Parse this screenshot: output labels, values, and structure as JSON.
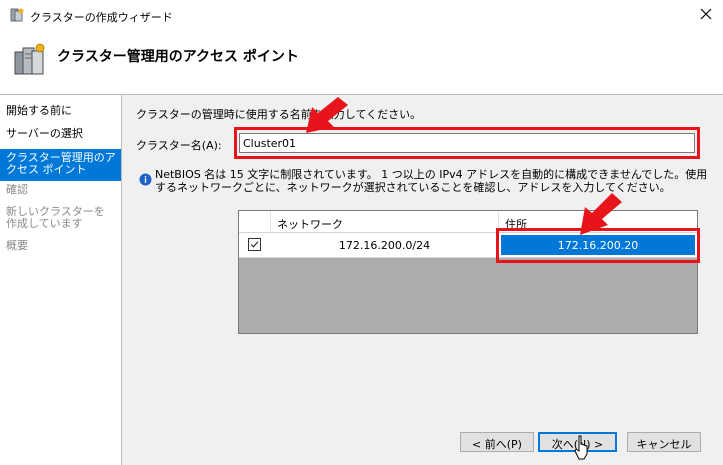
{
  "window": {
    "title": "クラスターの作成ウィザード",
    "header_title": "クラスター管理用のアクセス ポイント"
  },
  "nav": {
    "items": [
      {
        "label": "開始する前に",
        "state": "normal"
      },
      {
        "label": "サーバーの選択",
        "state": "normal"
      },
      {
        "label": "クラスター管理用のアクセス ポイント",
        "state": "active"
      },
      {
        "label": "確認",
        "state": "disabled"
      },
      {
        "label": "新しいクラスターを作成しています",
        "state": "disabled"
      },
      {
        "label": "概要",
        "state": "disabled"
      }
    ]
  },
  "content": {
    "instruction": "クラスターの管理時に使用する名前を入力してください。",
    "cluster_name_label": "クラスター名(A):",
    "cluster_name_value": "Cluster01",
    "info_text": "NetBIOS 名は 15 文字に制限されています。 1 つ以上の IPv4 アドレスを自動的に構成できませんでした。使用するネットワークごとに、ネットワークが選択されていることを確認し、アドレスを入力してください。"
  },
  "grid": {
    "headers": {
      "network": "ネットワーク",
      "address": "住所"
    },
    "rows": [
      {
        "checked": true,
        "network": "172.16.200.0/24",
        "address": "172.16.200.20"
      }
    ]
  },
  "buttons": {
    "back": "< 前へ(P)",
    "next": "次へ(N) >",
    "cancel": "キャンセル"
  },
  "colors": {
    "accent": "#0078d7",
    "highlight": "#e8141b",
    "panel": "#f0f0f0"
  },
  "icons": [
    "app-icon",
    "close-icon",
    "server-cluster-icon",
    "info-icon",
    "checkbox-icon",
    "cursor-icon"
  ]
}
